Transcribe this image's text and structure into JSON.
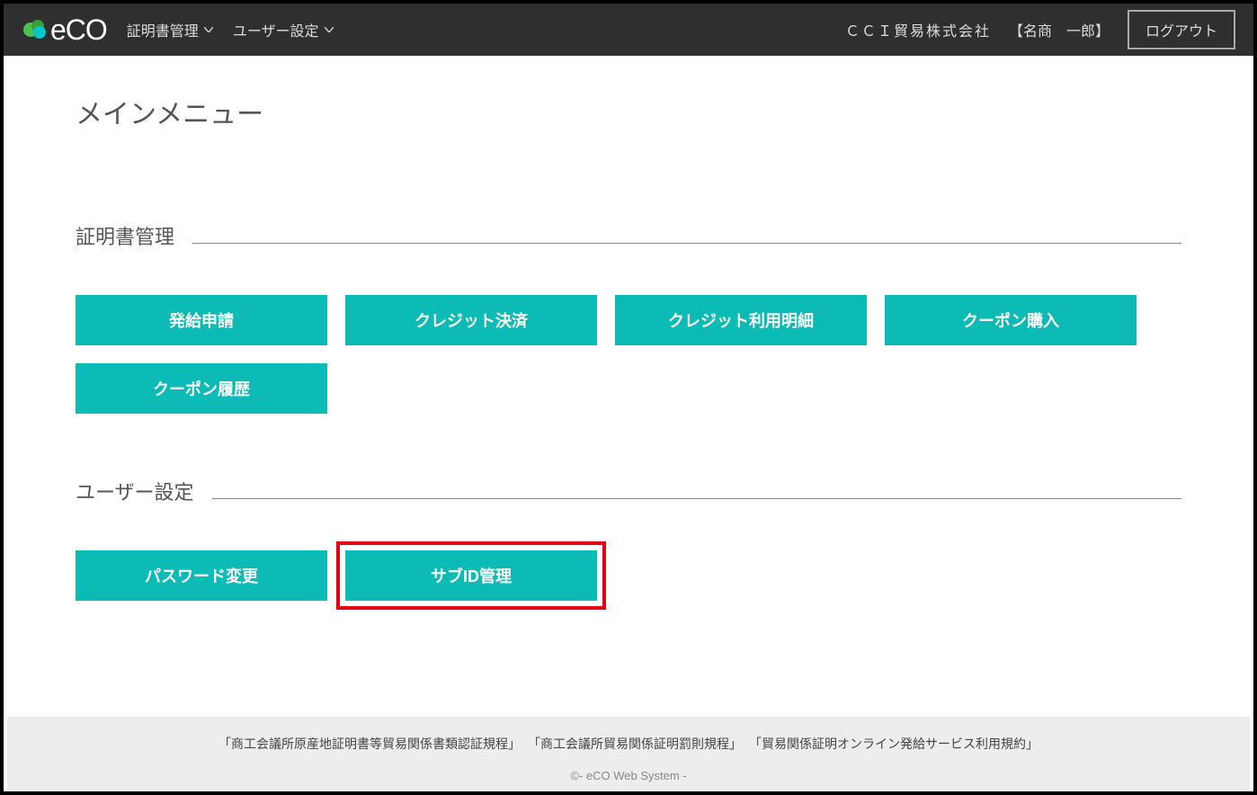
{
  "header": {
    "logo_text": "eCO",
    "nav": [
      {
        "label": "証明書管理"
      },
      {
        "label": "ユーザー設定"
      }
    ],
    "company": "ＣＣＩ貿易株式会社",
    "user": "【名商　一郎】",
    "logout": "ログアウト"
  },
  "page_title": "メインメニュー",
  "sections": [
    {
      "title": "証明書管理",
      "buttons": [
        {
          "label": "発給申請",
          "name": "issue-application-button"
        },
        {
          "label": "クレジット決済",
          "name": "credit-payment-button"
        },
        {
          "label": "クレジット利用明細",
          "name": "credit-statement-button"
        },
        {
          "label": "クーポン購入",
          "name": "coupon-purchase-button"
        },
        {
          "label": "クーポン履歴",
          "name": "coupon-history-button"
        }
      ]
    },
    {
      "title": "ユーザー設定",
      "buttons": [
        {
          "label": "パスワード変更",
          "name": "password-change-button"
        },
        {
          "label": "サブID管理",
          "name": "sub-id-management-button",
          "highlighted": true
        }
      ]
    }
  ],
  "footer": {
    "links": [
      "「商工会議所原産地証明書等貿易関係書類認証規程」",
      "「商工会議所貿易関係証明罰則規程」",
      "「貿易関係証明オンライン発給サービス利用規約」"
    ],
    "copyright": "©- eCO Web System -"
  }
}
